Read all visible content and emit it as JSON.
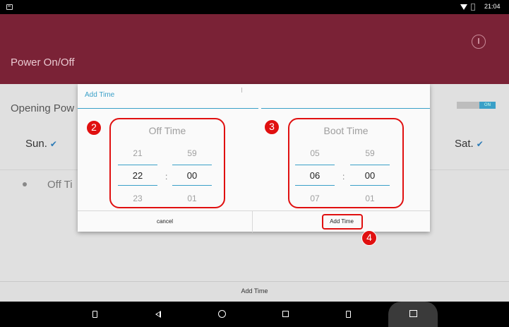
{
  "status_bar": {
    "time": "21:04"
  },
  "app": {
    "title": "Power On/Off"
  },
  "background": {
    "row_label": "Opening Pow",
    "toggle_label": "ON",
    "day_left": "Sun.",
    "day_right": "Sat.",
    "check_mark": "✔",
    "list_item": "Off Ti",
    "bottom_button": "Add Time"
  },
  "dialog": {
    "title": "Add Time",
    "off_time": {
      "title": "Off Time",
      "hours": [
        "21",
        "22",
        "23"
      ],
      "minutes": [
        "59",
        "00",
        "01"
      ]
    },
    "boot_time": {
      "title": "Boot Time",
      "hours": [
        "05",
        "06",
        "07"
      ],
      "minutes": [
        "59",
        "00",
        "01"
      ]
    },
    "separator": ":",
    "cancel_label": "cancel",
    "add_label": "Add Time"
  },
  "annotations": {
    "badge_off": "2",
    "badge_boot": "3",
    "badge_add": "4"
  },
  "colors": {
    "header": "#7a2236",
    "accent": "#3aa0c8",
    "highlight": "#e01010"
  }
}
